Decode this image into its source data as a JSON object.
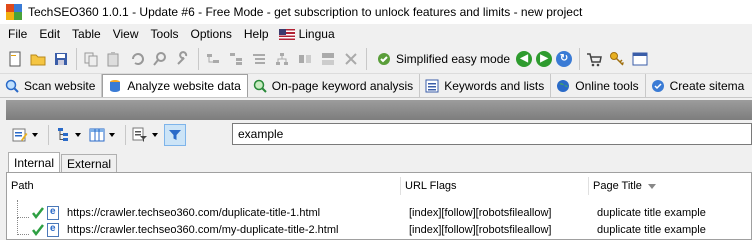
{
  "window": {
    "title": "TechSEO360 1.0.1 - Update #6 - Free Mode - get subscription to unlock features and limits - new project"
  },
  "menu": {
    "items": [
      {
        "label": "File"
      },
      {
        "label": "Edit"
      },
      {
        "label": "Table"
      },
      {
        "label": "View"
      },
      {
        "label": "Tools"
      },
      {
        "label": "Options"
      },
      {
        "label": "Help"
      }
    ],
    "lingua_label": "Lingua"
  },
  "toolbar": {
    "simplified_label": "Simplified easy mode"
  },
  "tabs": [
    {
      "label": "Scan website"
    },
    {
      "label": "Analyze website data"
    },
    {
      "label": "On-page keyword analysis"
    },
    {
      "label": "Keywords and lists"
    },
    {
      "label": "Online tools"
    },
    {
      "label": "Create sitema"
    }
  ],
  "filter": {
    "value": "example"
  },
  "subtabs": [
    {
      "label": "Internal"
    },
    {
      "label": "External"
    }
  ],
  "grid": {
    "columns": [
      {
        "label": "Path"
      },
      {
        "label": "URL Flags"
      },
      {
        "label": "Page Title"
      }
    ],
    "rows": [
      {
        "path": "https://crawler.techseo360.com/duplicate-title-1.html",
        "flags": "[index][follow][robotsfileallow]",
        "title": "duplicate title example"
      },
      {
        "path": "https://crawler.techseo360.com/my-duplicate-title-2.html",
        "flags": "[index][follow][robotsfileallow]",
        "title": "duplicate title example"
      }
    ]
  },
  "colors": {
    "accent_blue": "#3a7bd5",
    "check_green": "#2ea043",
    "nav_green": "#2e9b2e"
  }
}
